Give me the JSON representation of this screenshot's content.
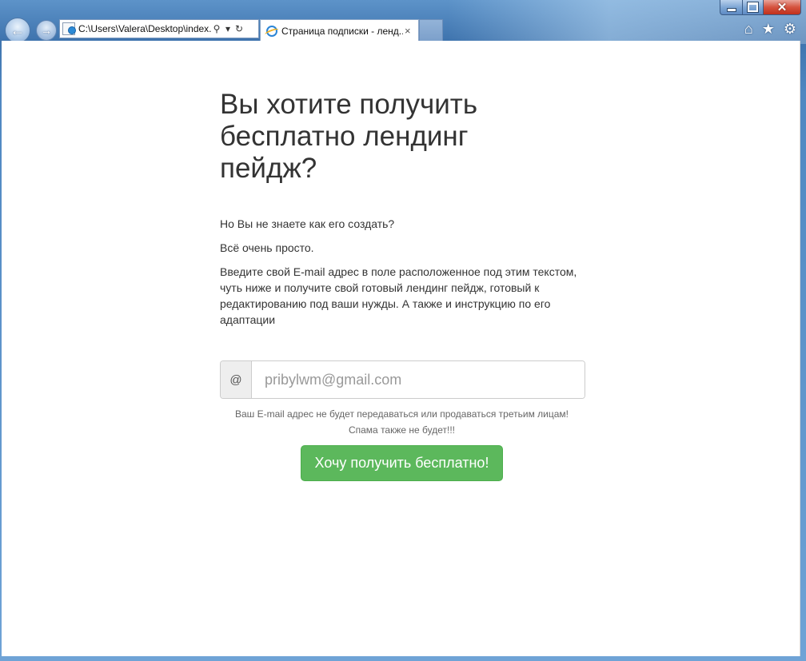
{
  "browser": {
    "address": "C:\\Users\\Valera\\Desktop\\index.",
    "tab_title": "Страница подписки - ленд...",
    "tab_close": "×",
    "search_glyph": "⚲",
    "dropdown_glyph": "▾",
    "refresh_glyph": "↻",
    "back_glyph": "←",
    "forward_glyph": "→",
    "home_glyph": "⌂",
    "favorites_glyph": "★",
    "tools_glyph": "⚙",
    "close_glyph": "✕"
  },
  "page": {
    "heading": "Вы хотите получить бесплатно лендинг пейдж?",
    "intro": "Но Вы не знаете как его создать?",
    "simple": "Всё очень просто.",
    "instruction": "Введите свой E-mail адрес в поле расположенное под этим текстом, чуть ниже и получите свой готовый лендинг пейдж, готовый к редактированию под ваши нужды. А также и инструкцию по его адаптации",
    "addon": "@",
    "email_placeholder": "pribylwm@gmail.com",
    "privacy_note": "Ваш E-mail адрес не будет передаваться или продаваться третьим лицам!",
    "spam_note": "Спама также не будет!!!",
    "cta_label": "Хочу получить бесплатно!",
    "cta_color": "#5cb85c"
  }
}
